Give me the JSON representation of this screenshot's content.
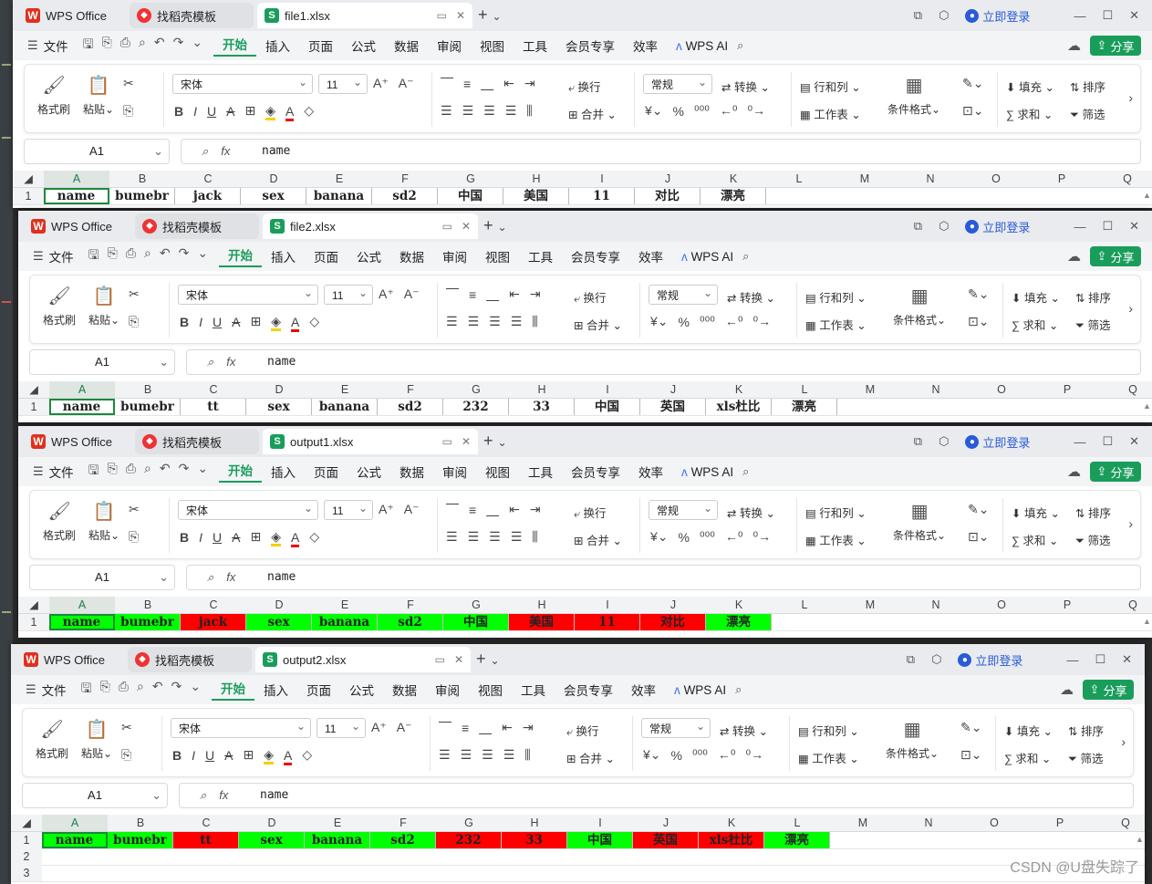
{
  "app": {
    "brand_tab": "WPS Office",
    "template_tab": "找稻壳模板",
    "login": "立即登录",
    "share": "分享",
    "wps_ai": "WPS AI"
  },
  "menu": [
    "文件",
    "开始",
    "插入",
    "页面",
    "公式",
    "数据",
    "审阅",
    "视图",
    "工具",
    "会员专享",
    "效率"
  ],
  "ribbon": {
    "format_painter": "格式刷",
    "paste": "粘贴",
    "font": "宋体",
    "size": "11",
    "wrap": "换行",
    "merge": "合并",
    "num_format": "常规",
    "convert": "转换",
    "rowcol": "行和列",
    "worksheet": "工作表",
    "cond_format": "条件格式",
    "fill": "填充",
    "sort": "排序",
    "sum": "求和",
    "filter": "筛选"
  },
  "columns_a": [
    "A",
    "B",
    "C",
    "D",
    "E",
    "F",
    "G",
    "H",
    "I",
    "J",
    "K",
    "L",
    "M",
    "N",
    "O",
    "P",
    "Q"
  ],
  "windows": [
    {
      "tab": "file1.xlsx",
      "cell_ref": "A1",
      "formula": "name",
      "rows": [
        "1"
      ],
      "cells": [
        {
          "v": "name",
          "c": ""
        },
        {
          "v": "bumebr",
          "c": ""
        },
        {
          "v": "jack",
          "c": ""
        },
        {
          "v": "sex",
          "c": ""
        },
        {
          "v": "banana",
          "c": ""
        },
        {
          "v": "sd2",
          "c": ""
        },
        {
          "v": "中国",
          "c": ""
        },
        {
          "v": "美国",
          "c": ""
        },
        {
          "v": "11",
          "c": ""
        },
        {
          "v": "对比",
          "c": ""
        },
        {
          "v": "漂亮",
          "c": ""
        }
      ]
    },
    {
      "tab": "file2.xlsx",
      "cell_ref": "A1",
      "formula": "name",
      "rows": [
        "1"
      ],
      "cells": [
        {
          "v": "name",
          "c": ""
        },
        {
          "v": "bumebr",
          "c": ""
        },
        {
          "v": "tt",
          "c": ""
        },
        {
          "v": "sex",
          "c": ""
        },
        {
          "v": "banana",
          "c": ""
        },
        {
          "v": "sd2",
          "c": ""
        },
        {
          "v": "232",
          "c": ""
        },
        {
          "v": "33",
          "c": ""
        },
        {
          "v": "中国",
          "c": ""
        },
        {
          "v": "英国",
          "c": ""
        },
        {
          "v": "xls杜比",
          "c": ""
        },
        {
          "v": "漂亮",
          "c": ""
        }
      ]
    },
    {
      "tab": "output1.xlsx",
      "cell_ref": "A1",
      "formula": "name",
      "rows": [
        "1"
      ],
      "cells": [
        {
          "v": "name",
          "c": "g"
        },
        {
          "v": "bumebr",
          "c": "g"
        },
        {
          "v": "jack",
          "c": "r"
        },
        {
          "v": "sex",
          "c": "g"
        },
        {
          "v": "banana",
          "c": "g"
        },
        {
          "v": "sd2",
          "c": "g"
        },
        {
          "v": "中国",
          "c": "g"
        },
        {
          "v": "美国",
          "c": "r"
        },
        {
          "v": "11",
          "c": "r"
        },
        {
          "v": "对比",
          "c": "r"
        },
        {
          "v": "漂亮",
          "c": "g"
        }
      ]
    },
    {
      "tab": "output2.xlsx",
      "cell_ref": "A1",
      "formula": "name",
      "rows": [
        "1",
        "2",
        "3"
      ],
      "cells": [
        {
          "v": "name",
          "c": "g"
        },
        {
          "v": "bumebr",
          "c": "g"
        },
        {
          "v": "tt",
          "c": "r"
        },
        {
          "v": "sex",
          "c": "g"
        },
        {
          "v": "banana",
          "c": "g"
        },
        {
          "v": "sd2",
          "c": "g"
        },
        {
          "v": "232",
          "c": "r"
        },
        {
          "v": "33",
          "c": "r"
        },
        {
          "v": "中国",
          "c": "g"
        },
        {
          "v": "英国",
          "c": "r"
        },
        {
          "v": "xls杜比",
          "c": "r"
        },
        {
          "v": "漂亮",
          "c": "g"
        }
      ]
    }
  ],
  "watermark": "CSDN @U盘失踪了",
  "colors": {
    "accent": "#1a9d5b",
    "match": "#00ff00",
    "diff": "#ff0000"
  }
}
